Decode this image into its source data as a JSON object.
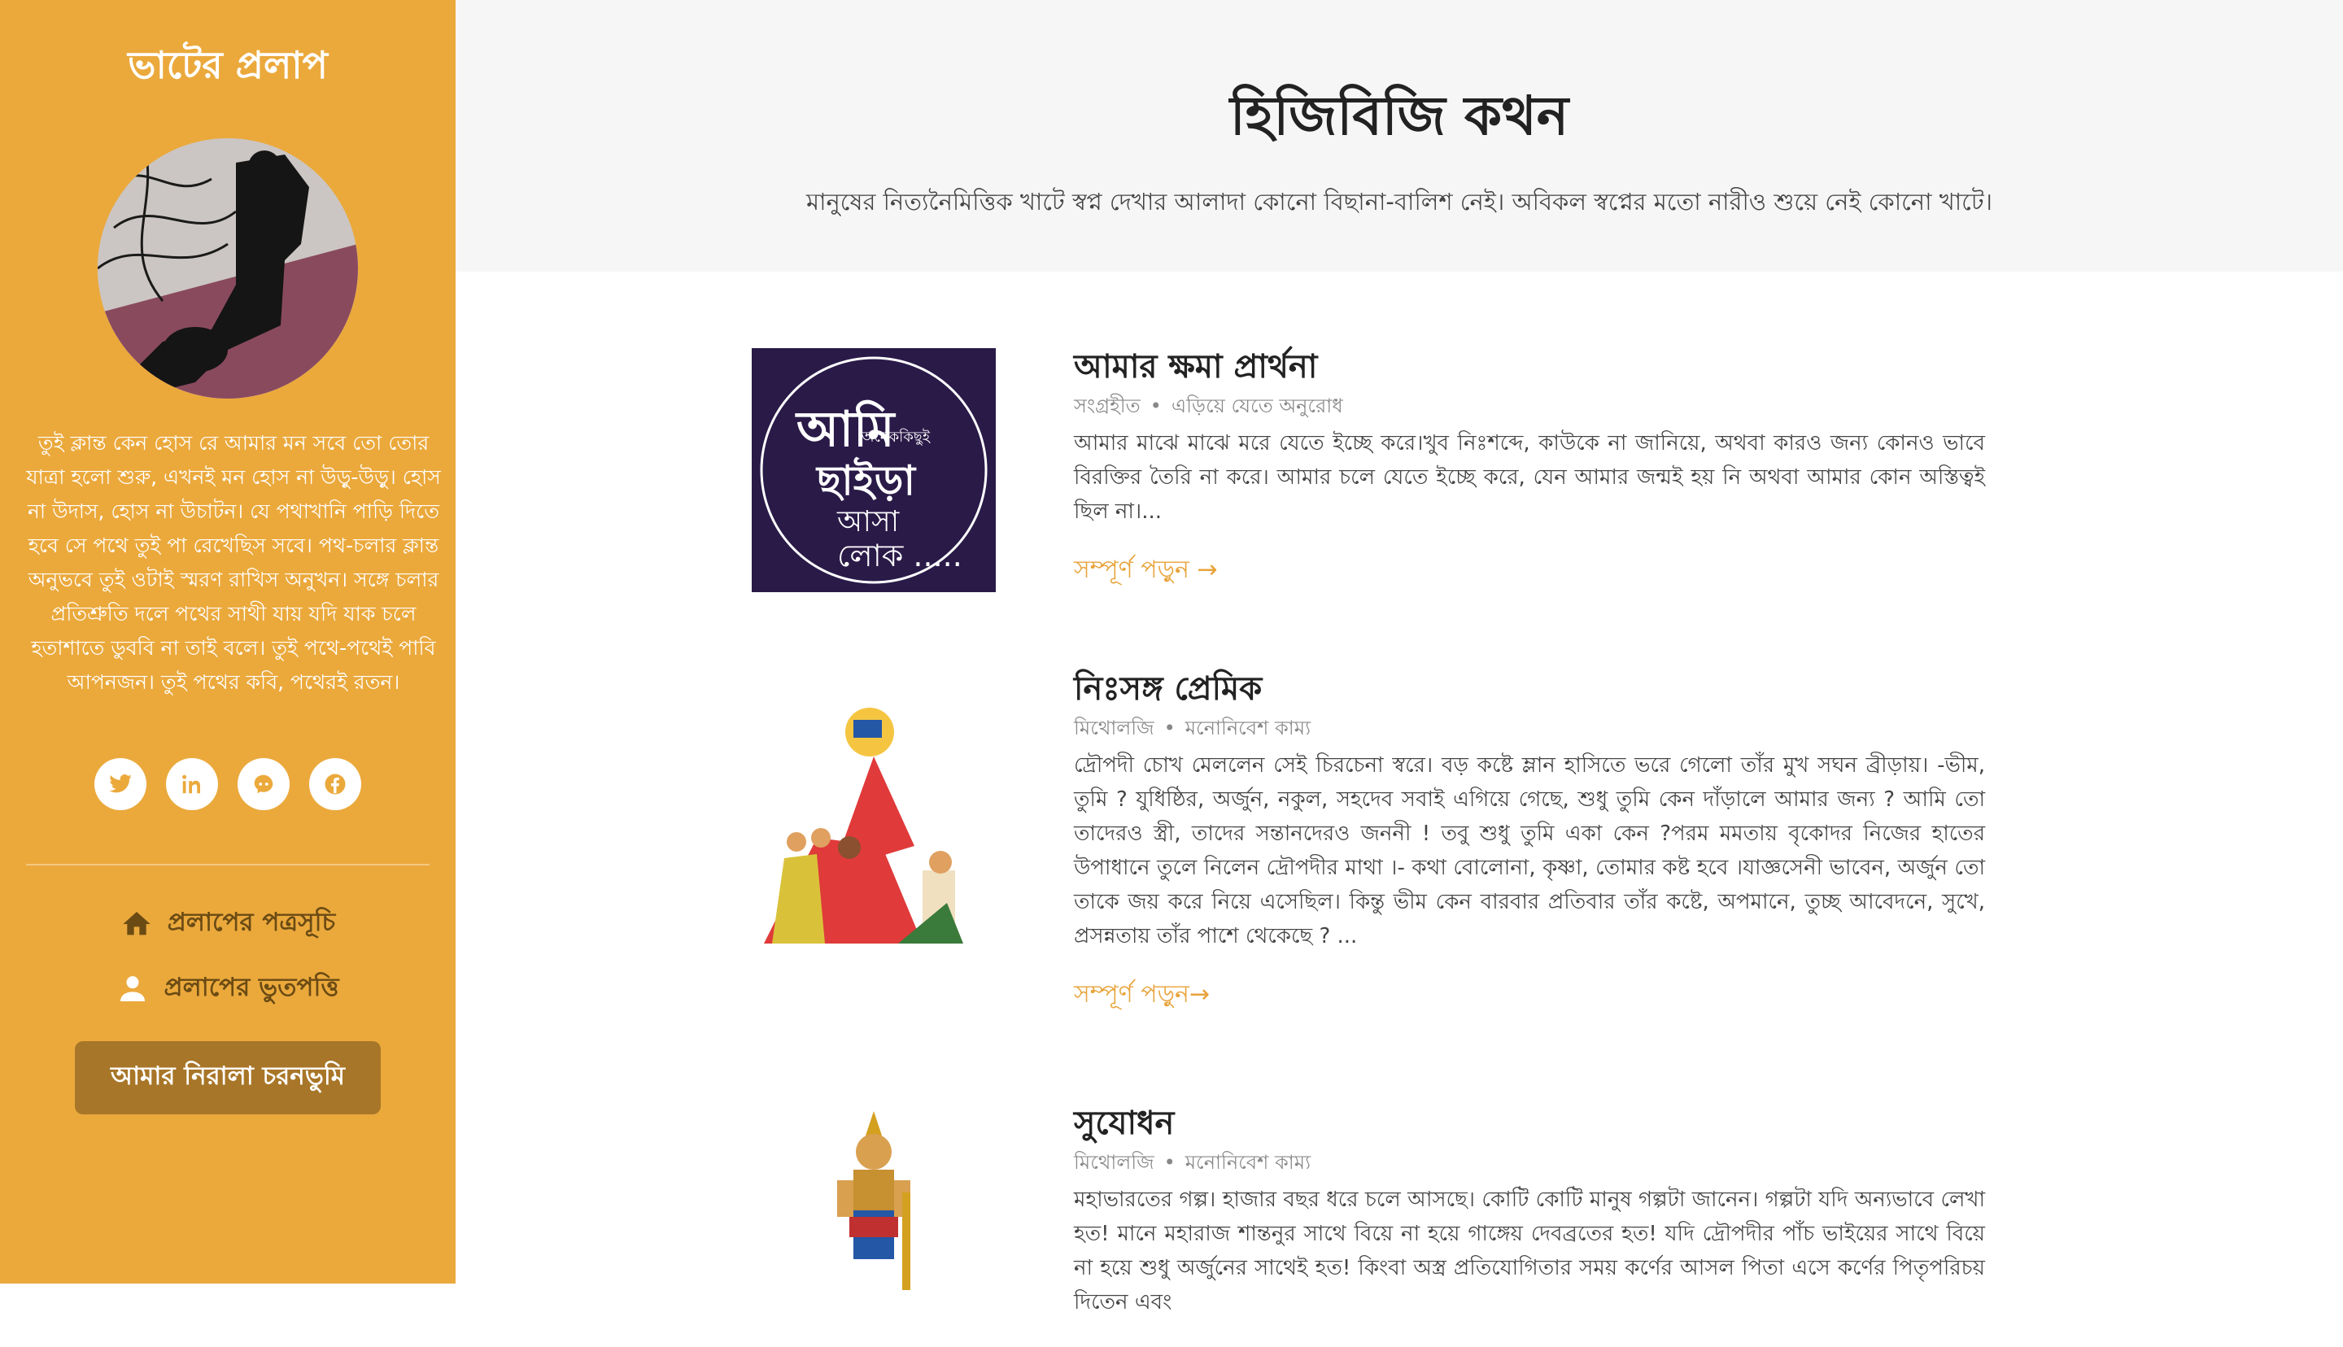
{
  "sidebar": {
    "site_title": "ভাটের প্রলাপ",
    "bio": "তুই ক্লান্ত কেন হোস রে আমার মন সবে তো তোর যাত্রা হলো শুরু, এখনই মন হোস না উড়ু-উড়ু। হোস না উদাস, হোস না উচাটন। যে পথাখানি পাড়ি দিতে হবে সে পথে তুই পা রেখেছিস সবে। পথ-চলার ক্লান্ত অনুভবে তুই ওটাই স্মরণ রাখিস অনুখন। সঙ্গে চলার প্রতিশ্রুতি দলে পথের সাথী যায় যদি যাক চলে হতাশাতে ডুববি না তাই বলে। তুই পথে-পথেই পাবি আপনজন। তুই পথের কবি, পথেরই রতন।",
    "social": [
      {
        "icon": "twitter-icon"
      },
      {
        "icon": "linkedin-icon"
      },
      {
        "icon": "github-icon"
      },
      {
        "icon": "facebook-icon"
      }
    ],
    "nav": [
      {
        "icon": "home-icon",
        "label": "প্রলাপের পত্রসূচি"
      },
      {
        "icon": "user-icon",
        "label": "প্রলাপের ভুতপত্তি"
      }
    ],
    "cta_label": "আমার নিরালা চরনভুমি"
  },
  "hero": {
    "title": "হিজিবিজি কথন",
    "subtitle": "মানুষের নিত্যনৈমিত্তিক খাটে স্বপ্ন দেখার আলাদা কোনো বিছানা-বালিশ নেই। অবিকল স্বপ্নের মতো নারীও শুয়ে নেই কোনো খাটে।"
  },
  "posts": [
    {
      "title": "আমার ক্ষমা প্রার্থনা",
      "category": "সংগ্রহীত",
      "tag": "এড়িয়ে যেতে অনুরোধ",
      "excerpt": "আমার মাঝে মাঝে মরে যেতে ইচ্ছে করে।খুব নিঃশব্দে, কাউকে না জানিয়ে, অথবা কারও জন্য কোনও ভাবে বিরক্তির তৈরি না করে। আমার চলে যেতে ইচ্ছে করে, যেন আমার জন্মই হয় নি অথবা আমার কোন অস্তিত্বই ছিল না।...",
      "read_more": "সম্পূর্ণ পড়ুন →",
      "thumb_text": {
        "line1": "আমি",
        "line2": "অনেককিছুই",
        "line3": "ছাইড়া",
        "line4": "আসা",
        "line5": "লোক ....."
      }
    },
    {
      "title": "নিঃসঙ্গ প্রেমিক",
      "category": "মিথোলজি",
      "tag": "মনোনিবেশ কাম্য",
      "excerpt": "দ্রৌপদী চোখ মেললেন সেই চিরচেনা স্বরে। বড় কষ্টে ম্লান হাসিতে ভরে গেলো তাঁর মুখ সঘন ব্রীড়ায়। -ভীম, তুমি ? যুধিষ্ঠির, অর্জুন, নকুল, সহদেব সবাই এগিয়ে গেছে, শুধু তুমি কেন দাঁড়ালে আমার জন্য ? আমি তো তাদেরও স্ত্রী, তাদের সন্তানদেরও জননী ! তবু শুধু তুমি একা কেন ?পরম মমতায় বৃকোদর নিজের হাতের উপাধানে তুলে নিলেন দ্রৌপদীর মাথা ।- কথা বোলোনা, কৃষ্ণা, তোমার কষ্ট হবে ।যাজ্ঞসেনী ভাবেন, অর্জুন তো তাকে জয় করে নিয়ে এসেছিল। কিন্তু ভীম কেন বারবার প্রতিবার তাঁর কষ্টে, অপমানে, তুচ্ছ আবেদনে, সুখে, প্রসন্নতায় তাঁর পাশে থেকেছে ? ...",
      "read_more": "সম্পূর্ণ পড়ুন→"
    },
    {
      "title": "সুযোধন",
      "category": "মিথোলজি",
      "tag": "মনোনিবেশ কাম্য",
      "excerpt": "মহাভারতের গল্প। হাজার বছর ধরে চলে আসছে। কোটি কোটি মানুষ গল্পটা জানেন। গল্পটা যদি অন্যভাবে লেখা হত! মানে মহারাজ শান্তনুর সাথে বিয়ে না হয়ে গাঙ্গেয় দেবব্রতের হত! যদি দ্রৌপদীর পাঁচ ভাইয়ের সাথে বিয়ে না হয়ে শুধু অর্জুনের সাথেই হত! কিংবা অস্ত্র প্রতিযোগিতার সময় কর্ণের আসল পিতা এসে কর্ণের পিতৃপরিচয় দিতেন এবং"
    }
  ],
  "colors": {
    "sidebar_bg": "#eba93c",
    "accent": "#e8a33a",
    "cta_bg": "#a87628",
    "nav_text": "#6b4b14"
  }
}
